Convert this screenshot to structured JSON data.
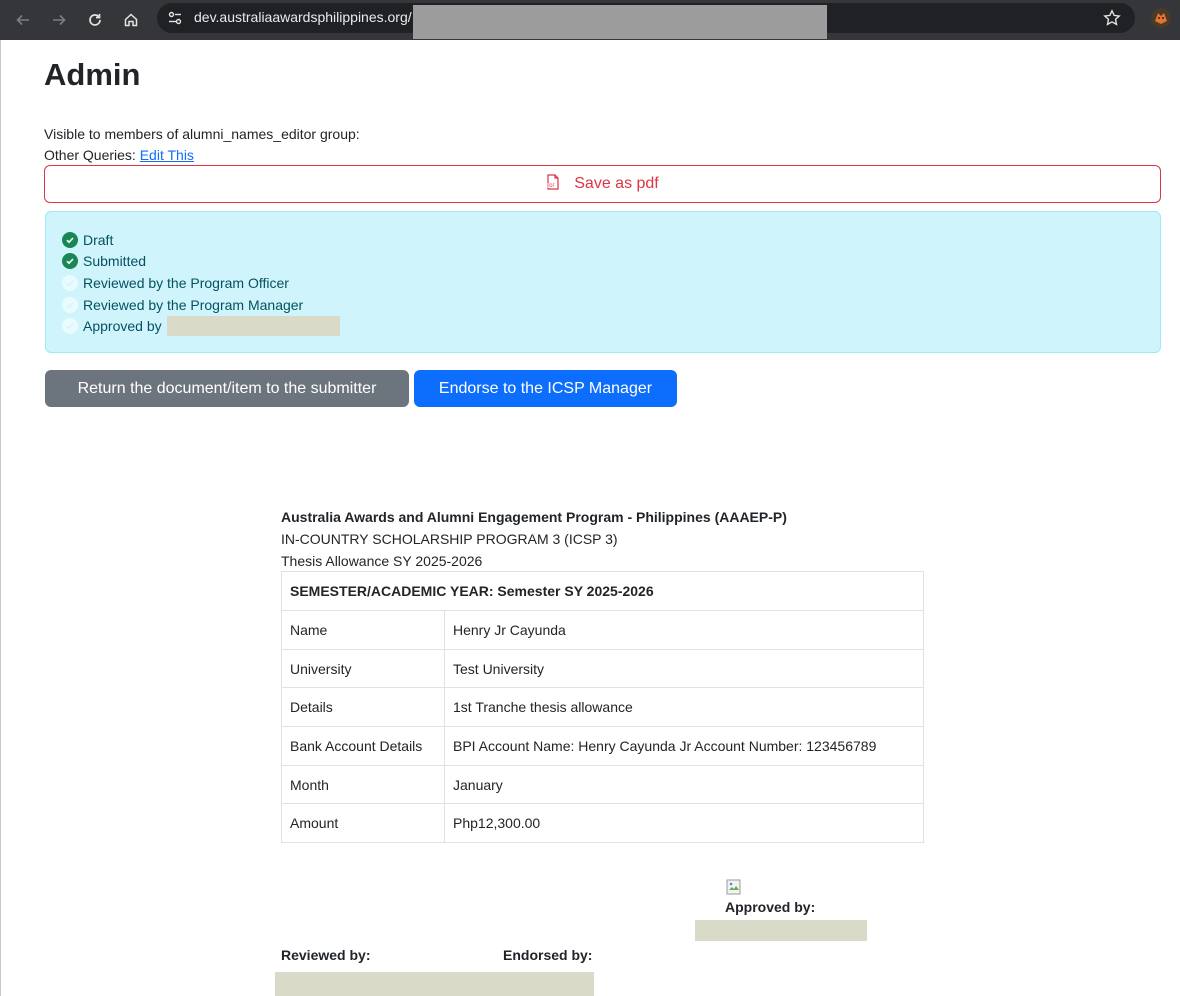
{
  "browser": {
    "url": "dev.australiaawardsphilippines.org/",
    "icons": [
      "back-arrow-icon",
      "forward-arrow-icon",
      "reload-icon",
      "home-icon",
      "site-settings-icon",
      "bookmark-star-icon",
      "extension-icon"
    ]
  },
  "page": {
    "title": "Admin",
    "visible_text": "Visible to members of alumni_names_editor group:",
    "other_queries_label": "Other Queries:",
    "edit_link": "Edit This",
    "save_pdf": "Save as pdf"
  },
  "status": {
    "items": [
      {
        "label": "Draft",
        "state": "done"
      },
      {
        "label": "Submitted",
        "state": "done"
      },
      {
        "label": "Reviewed by the Program Officer",
        "state": "pending"
      },
      {
        "label": "Reviewed by the Program Manager",
        "state": "pending"
      },
      {
        "label": "Approved by",
        "state": "pending"
      }
    ]
  },
  "actions": {
    "return_label": "Return the document/item to the submitter",
    "endorse_label": "Endorse to the ICSP Manager"
  },
  "document": {
    "org": "Australia Awards and Alumni Engagement Program - Philippines (AAAEP-P)",
    "program": "IN-COUNTRY SCHOLARSHIP PROGRAM 3 (ICSP 3)",
    "subtitle": "Thesis Allowance SY 2025-2026",
    "semester": "SEMESTER/ACADEMIC YEAR: Semester SY 2025-2026",
    "rows": [
      {
        "label": "Name",
        "value": "Henry Jr Cayunda"
      },
      {
        "label": "University",
        "value": "Test University"
      },
      {
        "label": "Details",
        "value": "1st Tranche thesis allowance"
      },
      {
        "label": "Bank Account Details",
        "value": "BPI Account Name: Henry Cayunda Jr Account Number: 123456789"
      },
      {
        "label": "Month",
        "value": "January"
      },
      {
        "label": "Amount",
        "value": "Php12,300.00"
      }
    ],
    "approved_by": "Approved by:",
    "reviewed_by": "Reviewed by:",
    "endorsed_by": "Endorsed by:"
  },
  "colors": {
    "danger": "#dc3545",
    "primary": "#0d6efd",
    "secondary": "#6c757d",
    "success": "#198754",
    "info_bg": "#cff4fc"
  }
}
